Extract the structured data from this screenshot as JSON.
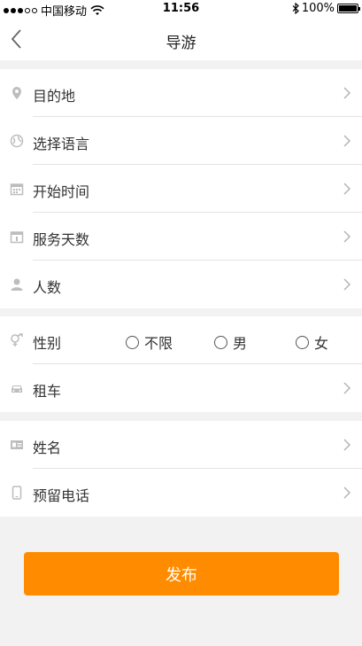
{
  "status_bar": {
    "carrier": "中国移动",
    "time": "11:56",
    "battery": "100%"
  },
  "navbar": {
    "title": "导游"
  },
  "group1": [
    {
      "label": "目的地",
      "icon": "location-pin-icon"
    },
    {
      "label": "选择语言",
      "icon": "globe-icon"
    },
    {
      "label": "开始时间",
      "icon": "calendar-icon"
    },
    {
      "label": "服务天数",
      "icon": "calendar-day-icon"
    },
    {
      "label": "人数",
      "icon": "person-icon"
    }
  ],
  "gender": {
    "label": "性别",
    "options": [
      "不限",
      "男",
      "女"
    ]
  },
  "car": {
    "label": "租车",
    "icon": "car-icon"
  },
  "group3": [
    {
      "label": "姓名",
      "icon": "id-card-icon"
    },
    {
      "label": "预留电话",
      "icon": "phone-icon"
    }
  ],
  "publish_label": "发布",
  "colors": {
    "accent": "#ff8c00",
    "background": "#f2f2f2",
    "icon": "#bdbdbd"
  }
}
